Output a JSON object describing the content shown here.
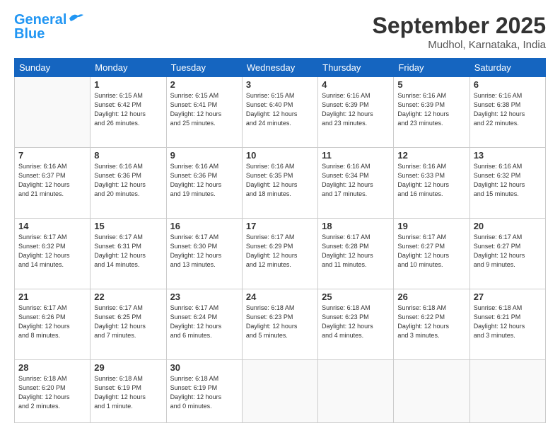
{
  "header": {
    "logo_line1": "General",
    "logo_line2": "Blue",
    "month": "September 2025",
    "location": "Mudhol, Karnataka, India"
  },
  "days_of_week": [
    "Sunday",
    "Monday",
    "Tuesday",
    "Wednesday",
    "Thursday",
    "Friday",
    "Saturday"
  ],
  "weeks": [
    [
      {
        "day": "",
        "info": ""
      },
      {
        "day": "1",
        "info": "Sunrise: 6:15 AM\nSunset: 6:42 PM\nDaylight: 12 hours\nand 26 minutes."
      },
      {
        "day": "2",
        "info": "Sunrise: 6:15 AM\nSunset: 6:41 PM\nDaylight: 12 hours\nand 25 minutes."
      },
      {
        "day": "3",
        "info": "Sunrise: 6:15 AM\nSunset: 6:40 PM\nDaylight: 12 hours\nand 24 minutes."
      },
      {
        "day": "4",
        "info": "Sunrise: 6:16 AM\nSunset: 6:39 PM\nDaylight: 12 hours\nand 23 minutes."
      },
      {
        "day": "5",
        "info": "Sunrise: 6:16 AM\nSunset: 6:39 PM\nDaylight: 12 hours\nand 23 minutes."
      },
      {
        "day": "6",
        "info": "Sunrise: 6:16 AM\nSunset: 6:38 PM\nDaylight: 12 hours\nand 22 minutes."
      }
    ],
    [
      {
        "day": "7",
        "info": "Sunrise: 6:16 AM\nSunset: 6:37 PM\nDaylight: 12 hours\nand 21 minutes."
      },
      {
        "day": "8",
        "info": "Sunrise: 6:16 AM\nSunset: 6:36 PM\nDaylight: 12 hours\nand 20 minutes."
      },
      {
        "day": "9",
        "info": "Sunrise: 6:16 AM\nSunset: 6:36 PM\nDaylight: 12 hours\nand 19 minutes."
      },
      {
        "day": "10",
        "info": "Sunrise: 6:16 AM\nSunset: 6:35 PM\nDaylight: 12 hours\nand 18 minutes."
      },
      {
        "day": "11",
        "info": "Sunrise: 6:16 AM\nSunset: 6:34 PM\nDaylight: 12 hours\nand 17 minutes."
      },
      {
        "day": "12",
        "info": "Sunrise: 6:16 AM\nSunset: 6:33 PM\nDaylight: 12 hours\nand 16 minutes."
      },
      {
        "day": "13",
        "info": "Sunrise: 6:16 AM\nSunset: 6:32 PM\nDaylight: 12 hours\nand 15 minutes."
      }
    ],
    [
      {
        "day": "14",
        "info": "Sunrise: 6:17 AM\nSunset: 6:32 PM\nDaylight: 12 hours\nand 14 minutes."
      },
      {
        "day": "15",
        "info": "Sunrise: 6:17 AM\nSunset: 6:31 PM\nDaylight: 12 hours\nand 14 minutes."
      },
      {
        "day": "16",
        "info": "Sunrise: 6:17 AM\nSunset: 6:30 PM\nDaylight: 12 hours\nand 13 minutes."
      },
      {
        "day": "17",
        "info": "Sunrise: 6:17 AM\nSunset: 6:29 PM\nDaylight: 12 hours\nand 12 minutes."
      },
      {
        "day": "18",
        "info": "Sunrise: 6:17 AM\nSunset: 6:28 PM\nDaylight: 12 hours\nand 11 minutes."
      },
      {
        "day": "19",
        "info": "Sunrise: 6:17 AM\nSunset: 6:27 PM\nDaylight: 12 hours\nand 10 minutes."
      },
      {
        "day": "20",
        "info": "Sunrise: 6:17 AM\nSunset: 6:27 PM\nDaylight: 12 hours\nand 9 minutes."
      }
    ],
    [
      {
        "day": "21",
        "info": "Sunrise: 6:17 AM\nSunset: 6:26 PM\nDaylight: 12 hours\nand 8 minutes."
      },
      {
        "day": "22",
        "info": "Sunrise: 6:17 AM\nSunset: 6:25 PM\nDaylight: 12 hours\nand 7 minutes."
      },
      {
        "day": "23",
        "info": "Sunrise: 6:17 AM\nSunset: 6:24 PM\nDaylight: 12 hours\nand 6 minutes."
      },
      {
        "day": "24",
        "info": "Sunrise: 6:18 AM\nSunset: 6:23 PM\nDaylight: 12 hours\nand 5 minutes."
      },
      {
        "day": "25",
        "info": "Sunrise: 6:18 AM\nSunset: 6:23 PM\nDaylight: 12 hours\nand 4 minutes."
      },
      {
        "day": "26",
        "info": "Sunrise: 6:18 AM\nSunset: 6:22 PM\nDaylight: 12 hours\nand 3 minutes."
      },
      {
        "day": "27",
        "info": "Sunrise: 6:18 AM\nSunset: 6:21 PM\nDaylight: 12 hours\nand 3 minutes."
      }
    ],
    [
      {
        "day": "28",
        "info": "Sunrise: 6:18 AM\nSunset: 6:20 PM\nDaylight: 12 hours\nand 2 minutes."
      },
      {
        "day": "29",
        "info": "Sunrise: 6:18 AM\nSunset: 6:19 PM\nDaylight: 12 hours\nand 1 minute."
      },
      {
        "day": "30",
        "info": "Sunrise: 6:18 AM\nSunset: 6:19 PM\nDaylight: 12 hours\nand 0 minutes."
      },
      {
        "day": "",
        "info": ""
      },
      {
        "day": "",
        "info": ""
      },
      {
        "day": "",
        "info": ""
      },
      {
        "day": "",
        "info": ""
      }
    ]
  ]
}
